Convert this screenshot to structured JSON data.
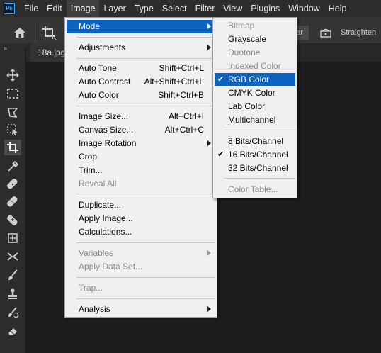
{
  "app": {
    "logo_text": "Ps"
  },
  "menubar": {
    "items": [
      {
        "label": "File",
        "active": false
      },
      {
        "label": "Edit",
        "active": false
      },
      {
        "label": "Image",
        "active": true
      },
      {
        "label": "Layer",
        "active": false
      },
      {
        "label": "Type",
        "active": false
      },
      {
        "label": "Select",
        "active": false
      },
      {
        "label": "Filter",
        "active": false
      },
      {
        "label": "View",
        "active": false
      },
      {
        "label": "Plugins",
        "active": false
      },
      {
        "label": "Window",
        "active": false
      },
      {
        "label": "Help",
        "active": false
      }
    ]
  },
  "options_bar": {
    "home_icon": "home-icon",
    "crop_icon": "crop-tool-icon",
    "clear_label": "ar",
    "level_icon": "level-icon",
    "straighten_label": "Straighten"
  },
  "toolbar": {
    "collapse_label": "››",
    "tools": [
      {
        "name": "move-tool-icon"
      },
      {
        "name": "marquee-tool-icon"
      },
      {
        "name": "lasso-tool-icon"
      },
      {
        "name": "object-selection-tool-icon"
      },
      {
        "name": "crop-tool-icon",
        "selected": true
      },
      {
        "name": "eyedropper-tool-icon"
      },
      {
        "name": "spot-healing-brush-icon"
      },
      {
        "name": "healing-brush-icon"
      },
      {
        "name": "patch-tool-icon"
      },
      {
        "name": "content-aware-move-icon"
      },
      {
        "name": "red-eye-tool-icon"
      },
      {
        "name": "brush-tool-icon"
      },
      {
        "name": "clone-stamp-tool-icon"
      },
      {
        "name": "history-brush-icon"
      },
      {
        "name": "eraser-tool-icon"
      }
    ]
  },
  "document": {
    "tab_label": "18a.jpg"
  },
  "image_menu": {
    "items": [
      {
        "label": "Mode",
        "shortcut": "",
        "submenu": true,
        "disabled": false,
        "highlighted": true
      },
      {
        "sep": true
      },
      {
        "label": "Adjustments",
        "shortcut": "",
        "submenu": true,
        "disabled": false
      },
      {
        "sep": true
      },
      {
        "label": "Auto Tone",
        "shortcut": "Shift+Ctrl+L",
        "submenu": false,
        "disabled": false
      },
      {
        "label": "Auto Contrast",
        "shortcut": "Alt+Shift+Ctrl+L",
        "submenu": false,
        "disabled": false
      },
      {
        "label": "Auto Color",
        "shortcut": "Shift+Ctrl+B",
        "submenu": false,
        "disabled": false
      },
      {
        "sep": true
      },
      {
        "label": "Image Size...",
        "shortcut": "Alt+Ctrl+I",
        "submenu": false,
        "disabled": false
      },
      {
        "label": "Canvas Size...",
        "shortcut": "Alt+Ctrl+C",
        "submenu": false,
        "disabled": false
      },
      {
        "label": "Image Rotation",
        "shortcut": "",
        "submenu": true,
        "disabled": false
      },
      {
        "label": "Crop",
        "shortcut": "",
        "submenu": false,
        "disabled": false
      },
      {
        "label": "Trim...",
        "shortcut": "",
        "submenu": false,
        "disabled": false
      },
      {
        "label": "Reveal All",
        "shortcut": "",
        "submenu": false,
        "disabled": true
      },
      {
        "sep": true
      },
      {
        "label": "Duplicate...",
        "shortcut": "",
        "submenu": false,
        "disabled": false
      },
      {
        "label": "Apply Image...",
        "shortcut": "",
        "submenu": false,
        "disabled": false
      },
      {
        "label": "Calculations...",
        "shortcut": "",
        "submenu": false,
        "disabled": false
      },
      {
        "sep": true
      },
      {
        "label": "Variables",
        "shortcut": "",
        "submenu": true,
        "disabled": true
      },
      {
        "label": "Apply Data Set...",
        "shortcut": "",
        "submenu": false,
        "disabled": true
      },
      {
        "sep": true
      },
      {
        "label": "Trap...",
        "shortcut": "",
        "submenu": false,
        "disabled": true
      },
      {
        "sep": true
      },
      {
        "label": "Analysis",
        "shortcut": "",
        "submenu": true,
        "disabled": false
      }
    ]
  },
  "mode_submenu": {
    "items": [
      {
        "label": "Bitmap",
        "disabled": true,
        "checked": false
      },
      {
        "label": "Grayscale",
        "disabled": false,
        "checked": false
      },
      {
        "label": "Duotone",
        "disabled": true,
        "checked": false
      },
      {
        "label": "Indexed Color",
        "disabled": true,
        "checked": false
      },
      {
        "label": "RGB Color",
        "disabled": false,
        "checked": true,
        "highlighted": true
      },
      {
        "label": "CMYK Color",
        "disabled": false,
        "checked": false
      },
      {
        "label": "Lab Color",
        "disabled": false,
        "checked": false
      },
      {
        "label": "Multichannel",
        "disabled": false,
        "checked": false
      },
      {
        "sep": true
      },
      {
        "label": "8 Bits/Channel",
        "disabled": false,
        "checked": false
      },
      {
        "label": "16 Bits/Channel",
        "disabled": false,
        "checked": true
      },
      {
        "label": "32 Bits/Channel",
        "disabled": false,
        "checked": false
      },
      {
        "sep": true
      },
      {
        "label": "Color Table...",
        "disabled": true,
        "checked": false
      }
    ]
  },
  "colors": {
    "menu_highlight": "#0c64c0",
    "menu_background": "#f0f0f0",
    "disabled_text": "#8a8a8a",
    "app_background": "#1d1d1d"
  }
}
